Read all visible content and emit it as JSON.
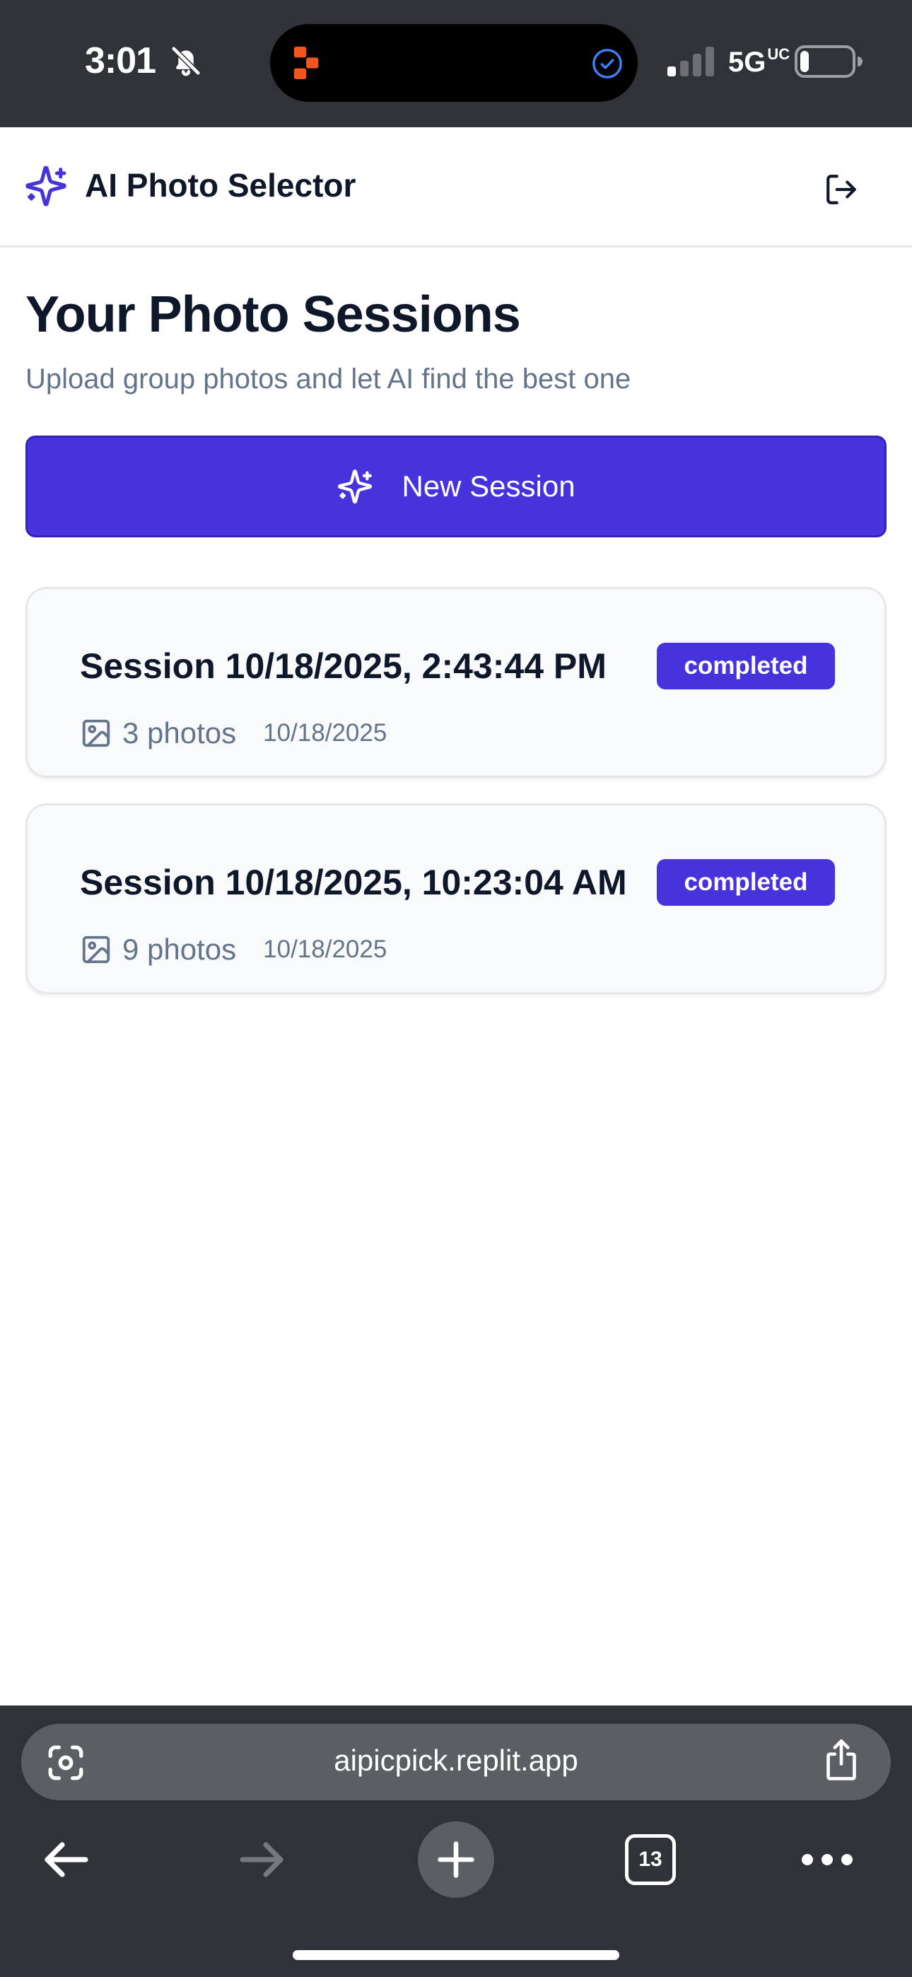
{
  "status_bar": {
    "time": "3:01",
    "network_main": "5G",
    "network_sup": "UC",
    "battery_level": 0.15
  },
  "header": {
    "title": "AI Photo Selector",
    "logo_icon": "sparkles-icon",
    "logout_icon": "log-out-icon"
  },
  "main": {
    "title": "Your Photo Sessions",
    "subtitle": "Upload group photos and let AI find the best one",
    "new_session_label": "New Session",
    "sessions": [
      {
        "title": "Session 10/18/2025, 2:43:44 PM",
        "status": "completed",
        "photos": "3 photos",
        "date": "10/18/2025"
      },
      {
        "title": "Session 10/18/2025, 10:23:04 AM",
        "status": "completed",
        "photos": "9 photos",
        "date": "10/18/2025"
      }
    ]
  },
  "browser": {
    "url": "aipicpick.replit.app",
    "tab_count": "13"
  },
  "colors": {
    "accent": "#4633dc",
    "status_bar_bg": "#2f3337",
    "text_primary": "#0f172a",
    "text_muted": "#64748b",
    "card_bg": "#f8fafc"
  }
}
